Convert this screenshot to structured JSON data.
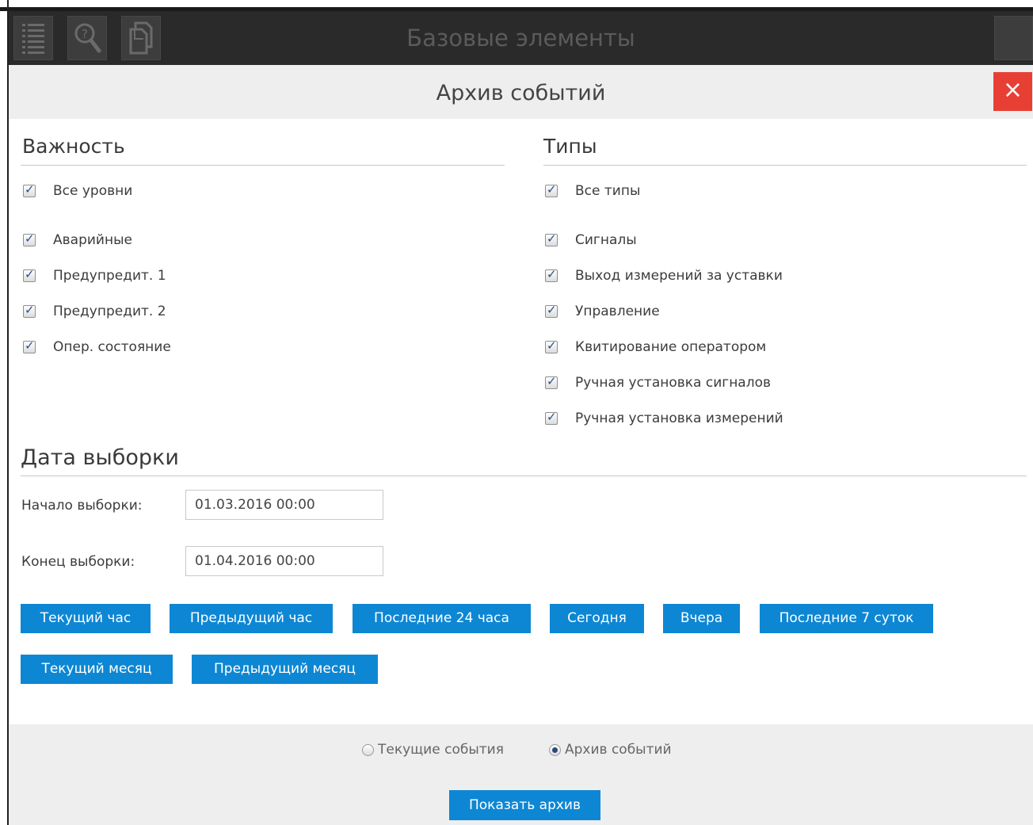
{
  "appbar": {
    "title": "Базовые элементы",
    "icons": [
      "list-menu-icon",
      "search-icon",
      "documents-icon"
    ]
  },
  "dialog": {
    "title": "Архив событий",
    "close_label": "×"
  },
  "importance": {
    "heading": "Важность",
    "all_label": "Все уровни",
    "items": [
      "Аварийные",
      "Предупредит. 1",
      "Предупредит. 2",
      "Опер. состояние"
    ],
    "checked": true
  },
  "types": {
    "heading": "Типы",
    "all_label": "Все типы",
    "items": [
      "Сигналы",
      "Выход измерений за уставки",
      "Управление",
      "Квитирование оператором",
      "Ручная установка сигналов",
      "Ручная установка измерений"
    ],
    "checked": true
  },
  "date": {
    "heading": "Дата выборки",
    "start_label": "Начало выборки:",
    "start_value": "01.03.2016 00:00",
    "end_label": "Конец выборки:",
    "end_value": "01.04.2016 00:00"
  },
  "quick_buttons": [
    "Текущий час",
    "Предыдущий час",
    "Последние 24 часа",
    "Сегодня",
    "Вчера",
    "Последние 7 суток",
    "Текущий месяц",
    "Предыдущий месяц"
  ],
  "footer": {
    "radio_current": "Текущие события",
    "radio_archive": "Архив событий",
    "selected": "archive",
    "show_button": "Показать архив"
  },
  "colors": {
    "accent": "#0d87d4",
    "close": "#e83f35",
    "appbar": "#2a2a2a",
    "header": "#eeeeef"
  }
}
